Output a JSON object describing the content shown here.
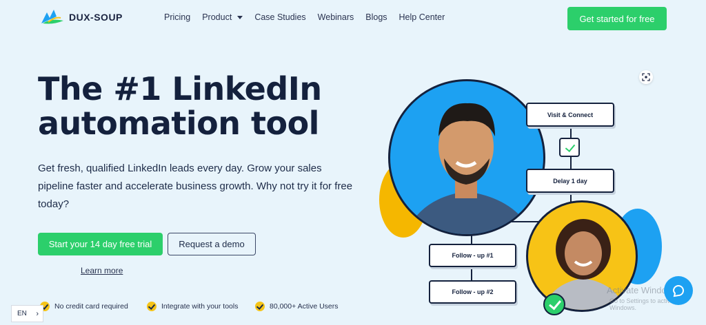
{
  "brand": {
    "name": "DUX-SOUP"
  },
  "nav": {
    "items": [
      {
        "label": "Pricing"
      },
      {
        "label": "Product",
        "has_dropdown": true
      },
      {
        "label": "Case Studies"
      },
      {
        "label": "Webinars"
      },
      {
        "label": "Blogs"
      },
      {
        "label": "Help Center"
      }
    ],
    "cta": "Get started for free"
  },
  "hero": {
    "headline_line1": "The #1 LinkedIn",
    "headline_line2": "automation tool",
    "subtitle": "Get fresh, qualified LinkedIn leads every day. Grow your sales pipeline faster and accelerate business growth. Why not try it for free today?",
    "primary_button": "Start your 14 day free trial",
    "secondary_button": "Request a demo",
    "learn_more": "Learn more"
  },
  "features": [
    {
      "label": "No credit card required"
    },
    {
      "label": "Integrate with your tools"
    },
    {
      "label": "80,000+ Active Users"
    }
  ],
  "language": {
    "current": "EN"
  },
  "workflow": {
    "steps": [
      "Visit & Connect",
      "Delay 1 day",
      "Follow - up #1",
      "Follow - up #2"
    ]
  },
  "watermark": {
    "line1": "Activate Windows",
    "line2": "Go to Settings to activate Windows."
  },
  "colors": {
    "accent_green": "#2ccf6b",
    "navy": "#14213d",
    "blue": "#1da1f2",
    "yellow": "#f5c418"
  }
}
